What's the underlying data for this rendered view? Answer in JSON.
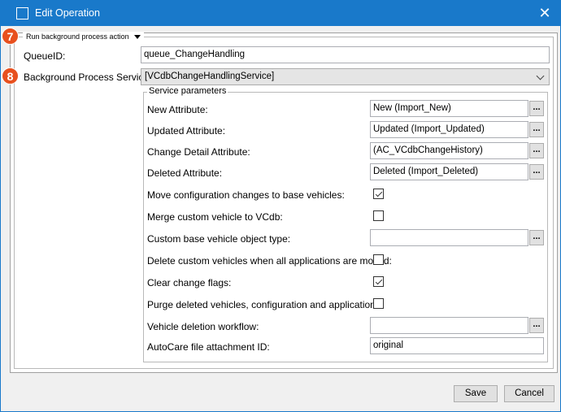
{
  "window": {
    "title": "Edit Operation"
  },
  "group": {
    "title": "Run background process action"
  },
  "badges": {
    "queue": "7",
    "service": "8"
  },
  "queue": {
    "label": "QueueID:",
    "value": "queue_ChangeHandling"
  },
  "service": {
    "label": "Background Process Service:",
    "selected": "[VCdbChangeHandlingService]"
  },
  "params": {
    "title": "Service parameters",
    "new_attr": {
      "label": "New Attribute:",
      "value": "New (Import_New)"
    },
    "updated_attr": {
      "label": "Updated Attribute:",
      "value": "Updated (Import_Updated)"
    },
    "change_detail_attr": {
      "label": "Change Detail Attribute:",
      "value": "(AC_VCdbChangeHistory)"
    },
    "deleted_attr": {
      "label": "Deleted Attribute:",
      "value": "Deleted (Import_Deleted)"
    },
    "move_config": {
      "label": "Move configuration changes to base vehicles:",
      "checked": true
    },
    "merge_custom": {
      "label": "Merge custom vehicle to VCdb:",
      "checked": false
    },
    "custom_base_type": {
      "label": "Custom base vehicle object type:",
      "value": ""
    },
    "delete_custom": {
      "label": "Delete custom vehicles when all applications are moved:",
      "checked": false
    },
    "clear_flags": {
      "label": "Clear change flags:",
      "checked": true
    },
    "purge_deleted": {
      "label": "Purge deleted vehicles, configuration and applications:",
      "checked": false
    },
    "deletion_workflow": {
      "label": "Vehicle deletion workflow:",
      "value": ""
    },
    "autocare_attachment": {
      "label": "AutoCare file attachment ID:",
      "value": "original"
    },
    "ellipsis": "..."
  },
  "buttons": {
    "save": "Save",
    "cancel": "Cancel"
  },
  "colors": {
    "titlebar": "#1979ca",
    "badge": "#e8501e"
  }
}
